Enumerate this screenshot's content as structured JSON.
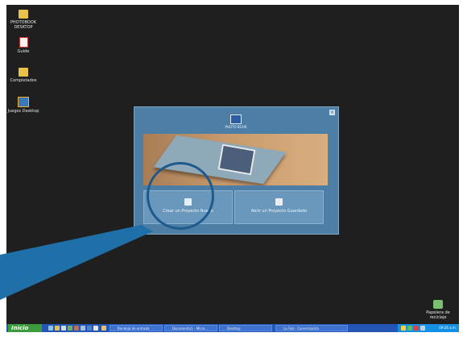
{
  "desktop_icons": [
    {
      "label": "PHOTOBOOK DESKTOP",
      "icon": "folder-icon"
    },
    {
      "label": "Guide",
      "icon": "document-icon"
    },
    {
      "label": "Completados",
      "icon": "folder-icon"
    },
    {
      "label": "Juegos Desktop",
      "icon": "game-icon"
    }
  ],
  "recycle_bin": {
    "label": "Papelera de reciclaje",
    "icon": "recycle-bin-icon"
  },
  "dialog": {
    "logo_text": "PHOTO BOOK",
    "close_label": "×",
    "btn_new": "Crear un Proyecto Nuevo",
    "btn_open": "Abrir un Proyecto Guardado"
  },
  "taskbar": {
    "start_label": "Inicio",
    "items": [
      "Bandeja de entrada",
      "Documento1 - Micro...",
      "Desktop",
      "La Fiat - Conversación"
    ],
    "clock": "09:26 a.m."
  }
}
